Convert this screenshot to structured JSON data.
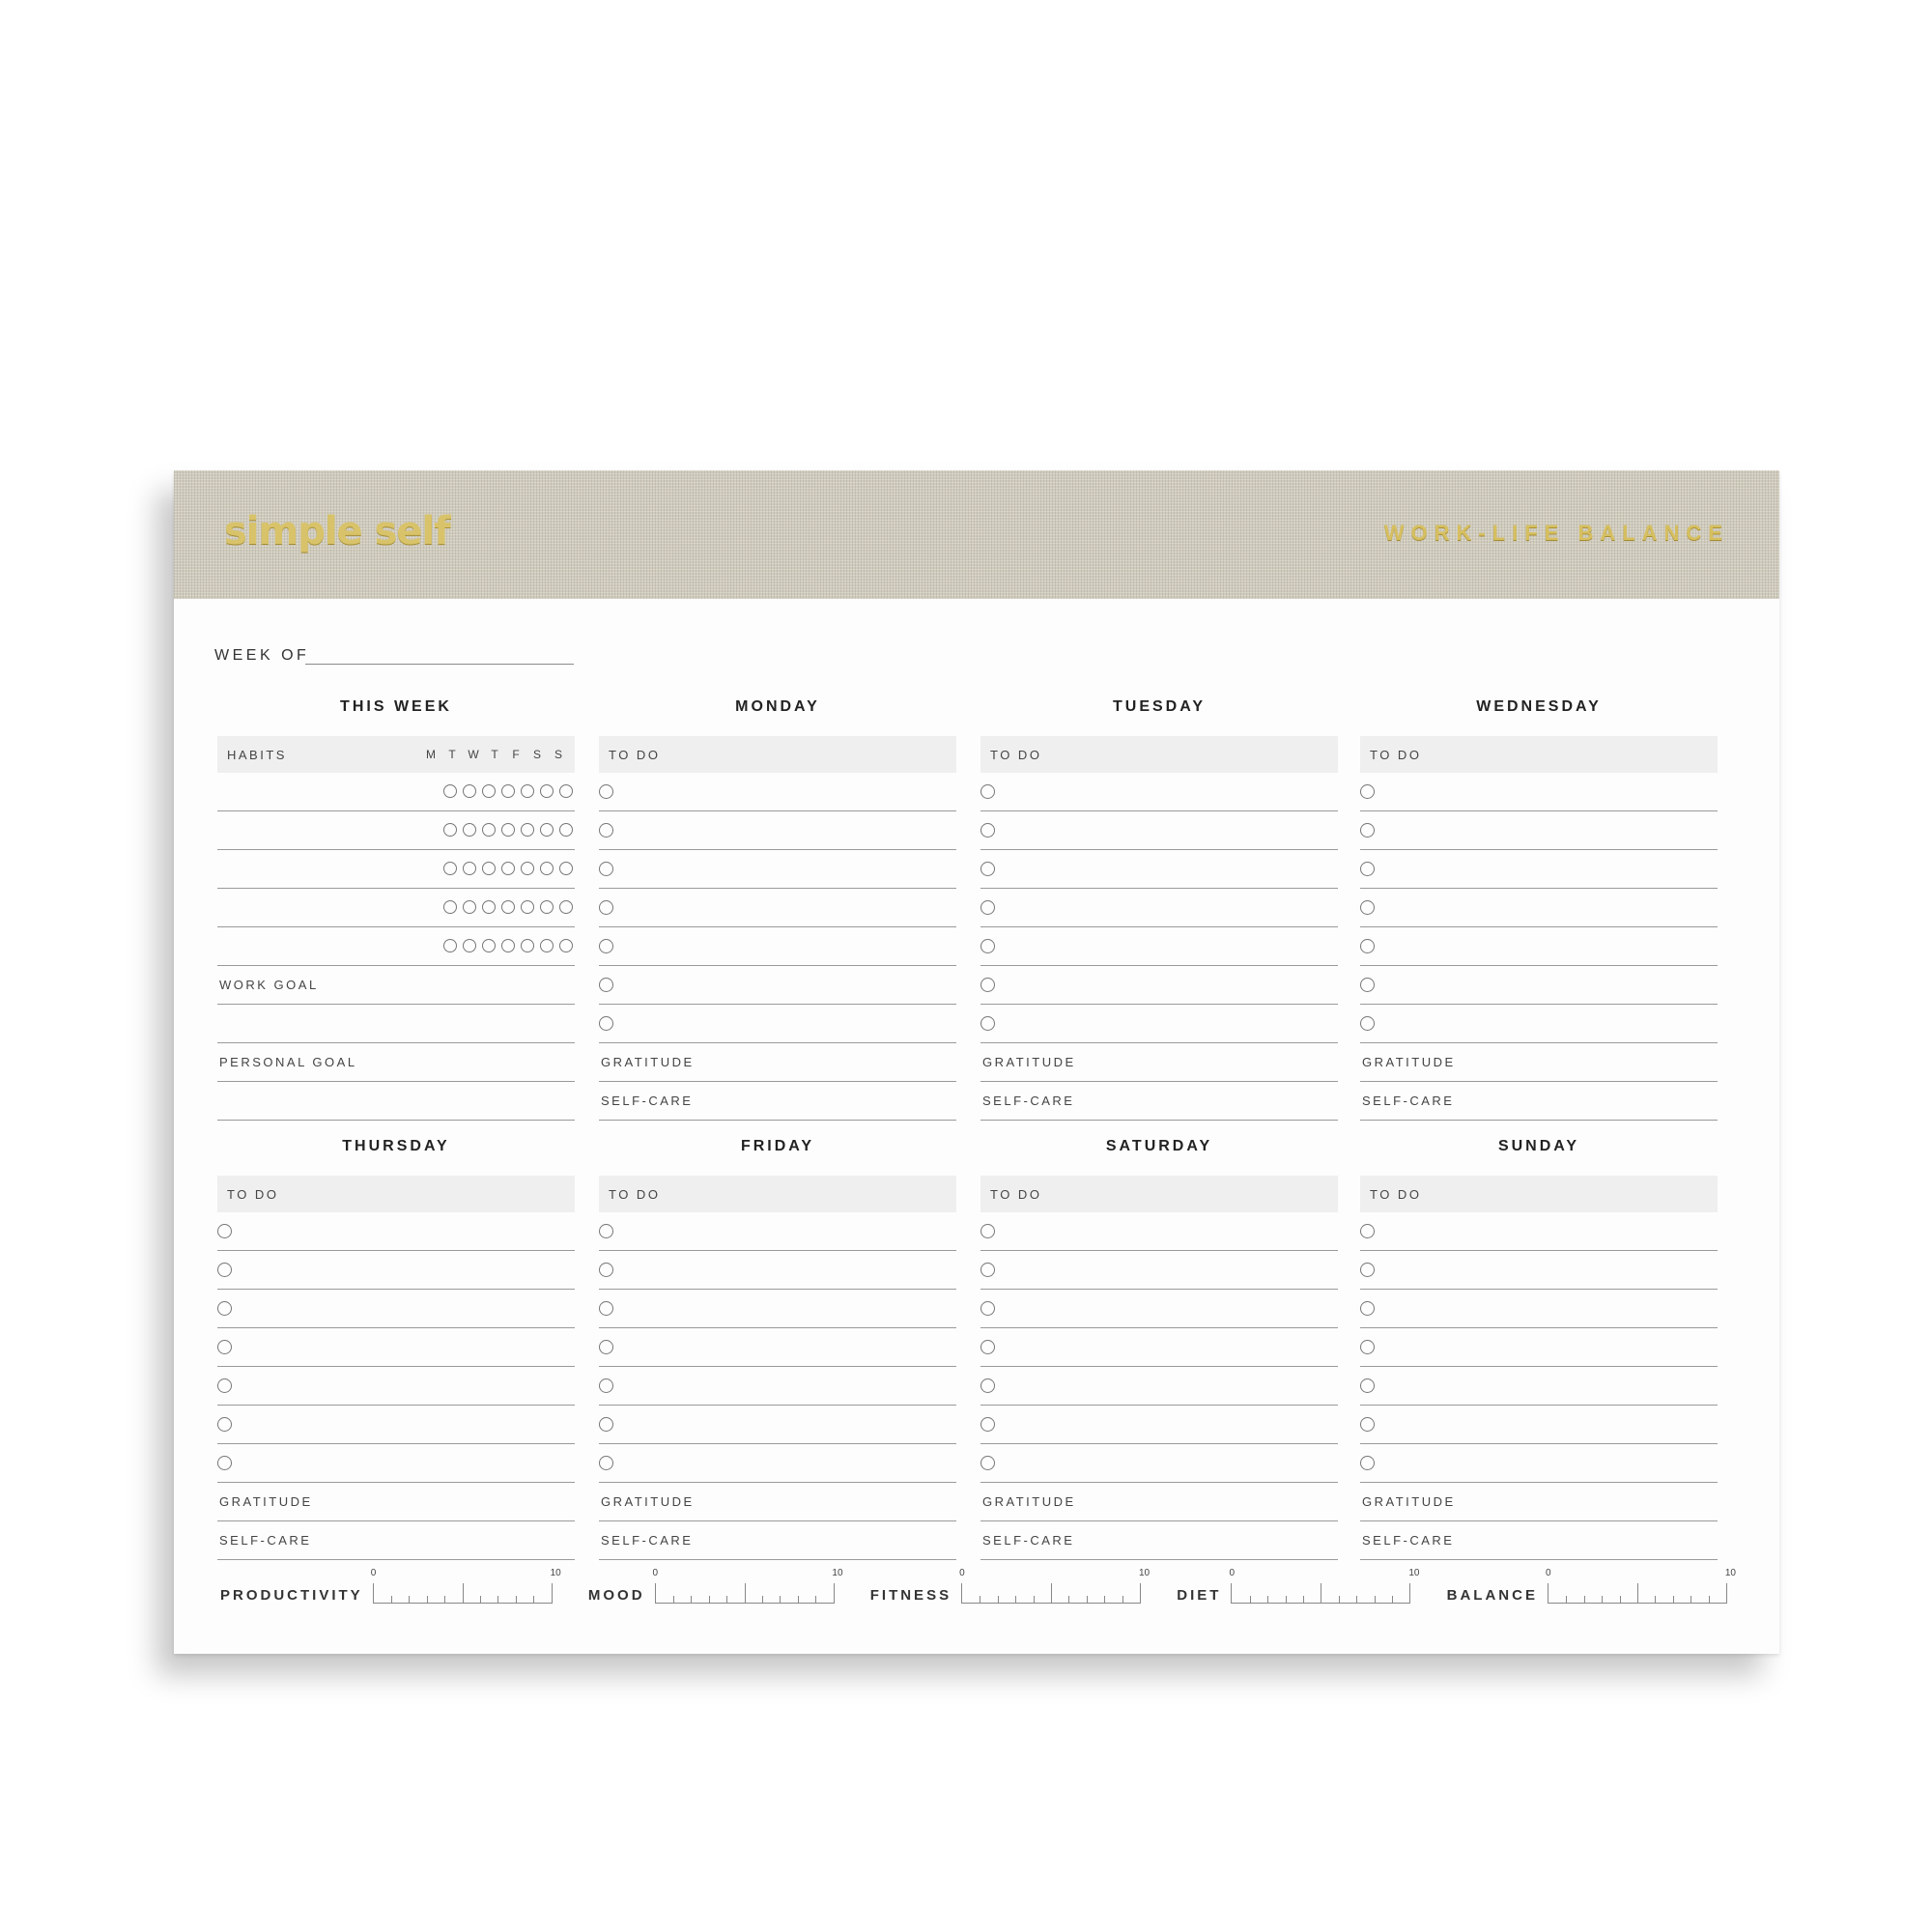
{
  "header": {
    "brand": "simple self",
    "product_title": "WORK-LIFE BALANCE",
    "band_color": "#cfcbbd",
    "foil_color": "#d9c36a"
  },
  "week_of": {
    "label": "WEEK OF",
    "value": ""
  },
  "this_week": {
    "title": "THIS WEEK",
    "habits_label": "HABITS",
    "day_letters": [
      "M",
      "T",
      "W",
      "T",
      "F",
      "S",
      "S"
    ],
    "habit_rows": 5,
    "work_goal_label": "WORK GOAL",
    "personal_goal_label": "PERSONAL GOAL"
  },
  "days": [
    {
      "name": "MONDAY"
    },
    {
      "name": "TUESDAY"
    },
    {
      "name": "WEDNESDAY"
    },
    {
      "name": "THURSDAY"
    },
    {
      "name": "FRIDAY"
    },
    {
      "name": "SATURDAY"
    },
    {
      "name": "SUNDAY"
    }
  ],
  "day_section": {
    "todo_label": "TO DO",
    "todo_rows": 7,
    "gratitude_label": "GRATITUDE",
    "selfcare_label": "SELF-CARE"
  },
  "scales": [
    {
      "label": "PRODUCTIVITY",
      "min": "0",
      "max": "10"
    },
    {
      "label": "MOOD",
      "min": "0",
      "max": "10"
    },
    {
      "label": "FITNESS",
      "min": "0",
      "max": "10"
    },
    {
      "label": "DIET",
      "min": "0",
      "max": "10"
    },
    {
      "label": "BALANCE",
      "min": "0",
      "max": "10"
    }
  ]
}
